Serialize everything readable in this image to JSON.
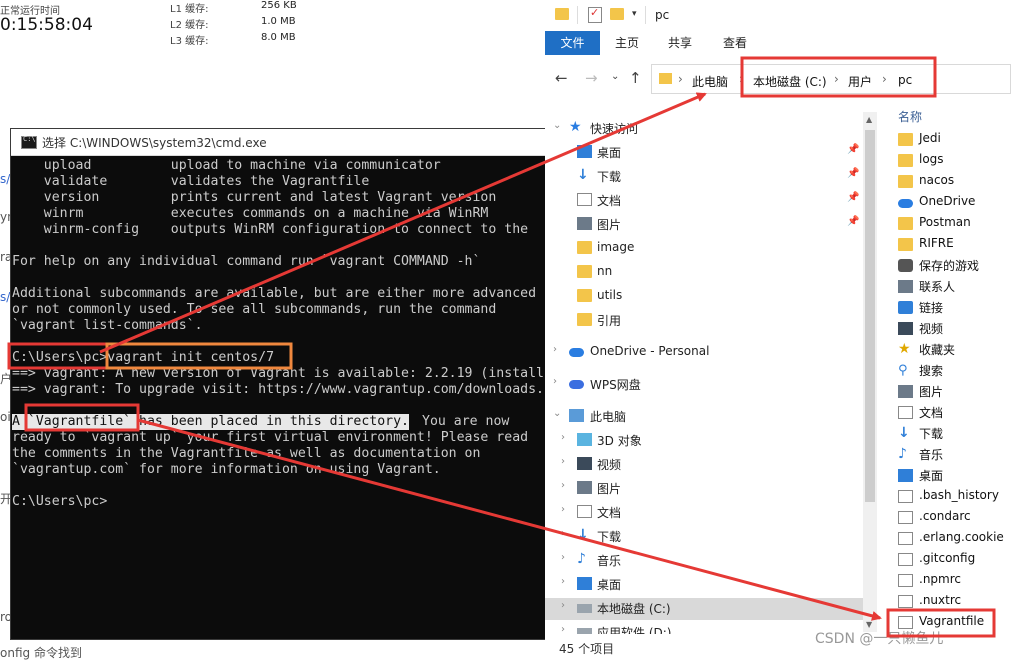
{
  "perf": {
    "uptime_label": "正常运行时间",
    "uptime_value": "0:15:58:04",
    "cache": [
      {
        "label": "L1 缓存:",
        "value": "256 KB"
      },
      {
        "label": "L2 缓存:",
        "value": "1.0 MB"
      },
      {
        "label": "L3 缓存:",
        "value": "8.0 MB"
      }
    ],
    "edge_fragments": [
      "s/",
      "yn",
      "ra",
      "s/",
      "户",
      "oi",
      "开",
      "ro",
      "onfig 命令找到"
    ]
  },
  "cmd": {
    "title": "选择 C:\\WINDOWS\\system32\\cmd.exe",
    "lines": [
      "    upload          upload to machine via communicator",
      "    validate        validates the Vagrantfile",
      "    version         prints current and latest Vagrant version",
      "    winrm           executes commands on a machine via WinRM",
      "    winrm-config    outputs WinRM configuration to connect to the",
      "",
      "For help on any individual command run `vagrant COMMAND -h`",
      "",
      "Additional subcommands are available, but are either more advanced",
      "or not commonly used. To see all subcommands, run the command",
      "`vagrant list-commands`.",
      "",
      "C:\\Users\\pc>vagrant init centos/7",
      "==> vagrant: A new version of Vagrant is available: 2.2.19 (install",
      "==> vagrant: To upgrade visit: https://www.vagrantup.com/downloads.",
      "",
      "A `Vagrantfile` has been placed in this directory. You are now",
      "ready to `vagrant up` your first virtual environment! Please read",
      "the comments in the Vagrantfile as well as documentation on",
      "`vagrantup.com` for more information on using Vagrant.",
      "",
      "C:\\Users\\pc>"
    ],
    "selected_text": "A `Vagrantfile` has been placed in this directory."
  },
  "explorer": {
    "window_title": "pc",
    "ribbon_tabs": [
      "文件",
      "主页",
      "共享",
      "查看"
    ],
    "breadcrumb": [
      "此电脑",
      "本地磁盘 (C:)",
      "用户",
      "pc"
    ],
    "nav": [
      {
        "label": "快速访问",
        "icon": "star-icon",
        "pinned": false,
        "expand": true
      },
      {
        "label": "桌面",
        "icon": "desktop-icon",
        "pinned": true
      },
      {
        "label": "下载",
        "icon": "download-icon",
        "pinned": true
      },
      {
        "label": "文档",
        "icon": "document-icon",
        "pinned": true
      },
      {
        "label": "图片",
        "icon": "picture-icon",
        "pinned": true
      },
      {
        "label": "image",
        "icon": "folder-icon",
        "pinned": false
      },
      {
        "label": "nn",
        "icon": "folder-icon",
        "pinned": false
      },
      {
        "label": "utils",
        "icon": "folder-icon",
        "pinned": false
      },
      {
        "label": "引用",
        "icon": "folder-icon",
        "pinned": false
      },
      {
        "label": "OneDrive - Personal",
        "icon": "onedrive-icon",
        "pinned": false,
        "expand": true
      },
      {
        "label": "WPS网盘",
        "icon": "cloud-icon",
        "pinned": false,
        "expand": true
      },
      {
        "label": "此电脑",
        "icon": "computer-icon",
        "pinned": false,
        "expand": true
      },
      {
        "label": "3D 对象",
        "icon": "cube-icon",
        "pinned": false,
        "expand": true
      },
      {
        "label": "视频",
        "icon": "video-icon",
        "pinned": false,
        "expand": true
      },
      {
        "label": "图片",
        "icon": "picture-icon",
        "pinned": false,
        "expand": true
      },
      {
        "label": "文档",
        "icon": "document-icon",
        "pinned": false,
        "expand": true
      },
      {
        "label": "下载",
        "icon": "download-icon",
        "pinned": false,
        "expand": true
      },
      {
        "label": "音乐",
        "icon": "music-icon",
        "pinned": false,
        "expand": true
      },
      {
        "label": "桌面",
        "icon": "desktop-icon",
        "pinned": false,
        "expand": true
      },
      {
        "label": "本地磁盘 (C:)",
        "icon": "drive-icon",
        "pinned": false,
        "expand": true,
        "selected": true
      },
      {
        "label": "应用软件 (D:)",
        "icon": "drive-icon",
        "pinned": false,
        "expand": true
      }
    ],
    "column_header": "名称",
    "files": [
      {
        "label": "Jedi",
        "icon": "folder-icon"
      },
      {
        "label": "logs",
        "icon": "folder-icon"
      },
      {
        "label": "nacos",
        "icon": "folder-icon"
      },
      {
        "label": "OneDrive",
        "icon": "onedrive-icon"
      },
      {
        "label": "Postman",
        "icon": "folder-icon"
      },
      {
        "label": "RIFRE",
        "icon": "folder-icon"
      },
      {
        "label": "保存的游戏",
        "icon": "game-icon"
      },
      {
        "label": "联系人",
        "icon": "contacts-icon"
      },
      {
        "label": "链接",
        "icon": "link-icon"
      },
      {
        "label": "视频",
        "icon": "video-icon"
      },
      {
        "label": "收藏夹",
        "icon": "favorites-icon"
      },
      {
        "label": "搜索",
        "icon": "search-icon"
      },
      {
        "label": "图片",
        "icon": "picture-icon"
      },
      {
        "label": "文档",
        "icon": "document-icon"
      },
      {
        "label": "下载",
        "icon": "download-icon"
      },
      {
        "label": "音乐",
        "icon": "music-icon"
      },
      {
        "label": "桌面",
        "icon": "desktop-icon"
      },
      {
        "label": ".bash_history",
        "icon": "file-icon"
      },
      {
        "label": ".condarc",
        "icon": "file-icon"
      },
      {
        "label": ".erlang.cookie",
        "icon": "file-icon"
      },
      {
        "label": ".gitconfig",
        "icon": "config-file-icon"
      },
      {
        "label": ".npmrc",
        "icon": "file-icon"
      },
      {
        "label": ".nuxtrc",
        "icon": "file-icon"
      },
      {
        "label": "Vagrantfile",
        "icon": "file-icon"
      }
    ],
    "status": "45 个项目"
  },
  "watermark": "CSDN @一只懒鱼儿",
  "colors": {
    "annotation_red": "#e53935",
    "annotation_orange": "#f0883e",
    "ribbon_blue": "#1f6fc5",
    "folder_yellow": "#f3c54a"
  }
}
